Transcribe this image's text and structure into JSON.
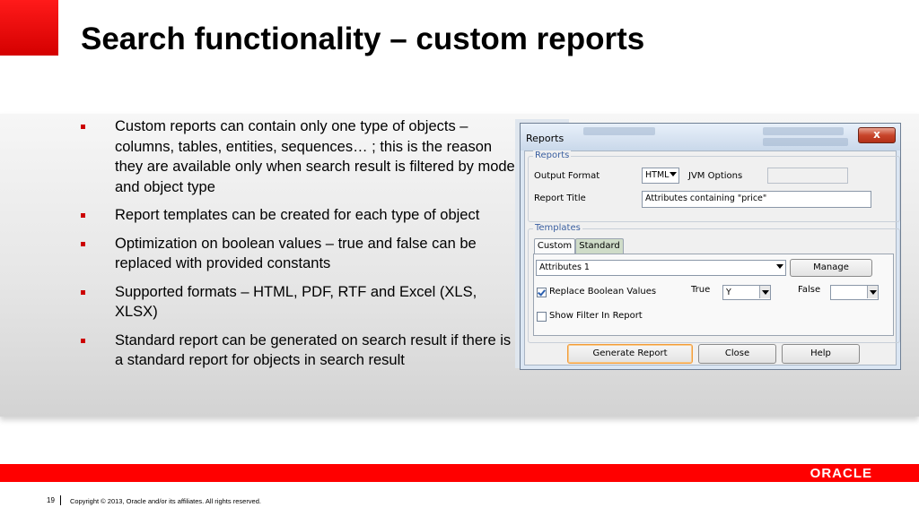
{
  "slide": {
    "title": "Search functionality – custom reports",
    "bullets": [
      "Custom reports can contain only one type of objects – columns, tables, entities, sequences… ; this is the reason they are available only when search result is filtered by model and object type",
      "Report templates can be created for each type of object",
      "Optimization on boolean values – true and false can be replaced with provided constants",
      "Supported formats – HTML, PDF, RTF and Excel (XLS, XLSX)",
      "Standard report can be generated on search result if there is a standard report for objects in search result"
    ],
    "page_number": "19",
    "copyright": "Copyright © 2013, Oracle and/or its affiliates. All rights reserved.",
    "logo_text": "ORACLE",
    "accent_color": "#ff0000"
  },
  "dialog": {
    "title": "Reports",
    "close_label": "x",
    "reports_group": {
      "legend": "Reports",
      "output_format_label": "Output Format",
      "output_format_value": "HTML",
      "jvm_options_label": "JVM Options",
      "jvm_options_value": "",
      "report_title_label": "Report Title",
      "report_title_value": "Attributes containing \"price\""
    },
    "templates_group": {
      "legend": "Templates",
      "tabs": [
        "Custom",
        "Standard"
      ],
      "template_value": "Attributes 1",
      "manage_label": "Manage",
      "replace_boolean_label": "Replace Boolean Values",
      "replace_boolean_checked": true,
      "true_label": "True",
      "true_value": "Y",
      "false_label": "False",
      "false_value": "",
      "show_filter_label": "Show Filter In Report",
      "show_filter_checked": false
    },
    "buttons": {
      "generate": "Generate Report",
      "close": "Close",
      "help": "Help"
    }
  }
}
